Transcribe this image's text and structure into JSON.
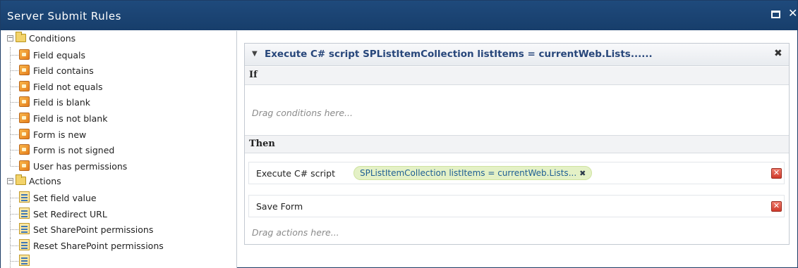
{
  "window": {
    "title": "Server Submit Rules",
    "maximize_glyph": "□",
    "close_glyph": "✕"
  },
  "tree": {
    "groups": [
      {
        "label": "Conditions",
        "icon": "folder-icon",
        "items": [
          "Field equals",
          "Field contains",
          "Field not equals",
          "Field is blank",
          "Field is not blank",
          "Form is new",
          "Form is not signed",
          "User has permissions"
        ]
      },
      {
        "label": "Actions",
        "icon": "folder-icon",
        "items": [
          "Set field value",
          "Set Redirect URL",
          "Set SharePoint permissions",
          "Reset SharePoint permissions"
        ]
      }
    ]
  },
  "rule": {
    "title": "Execute C# script SPListItemCollection listItems = currentWeb.Lists......",
    "collapse_glyph": "▼",
    "remove_glyph": "✖",
    "if_label": "If",
    "conditions_hint": "Drag conditions here...",
    "then_label": "Then",
    "actions": [
      {
        "name": "Execute C# script",
        "param": "SPListItemCollection listItems = currentWeb.Lists...",
        "param_remove": "✖",
        "delete": "✕"
      },
      {
        "name": "Save Form",
        "param": "",
        "delete": "✕"
      }
    ],
    "actions_hint": "Drag actions here..."
  },
  "colors": {
    "titlebar": "#1f4a7c",
    "rule_title": "#27467a",
    "pill_bg": "#e4f1c6",
    "pill_text": "#1f5f94",
    "delete_red": "#d03a2b"
  }
}
